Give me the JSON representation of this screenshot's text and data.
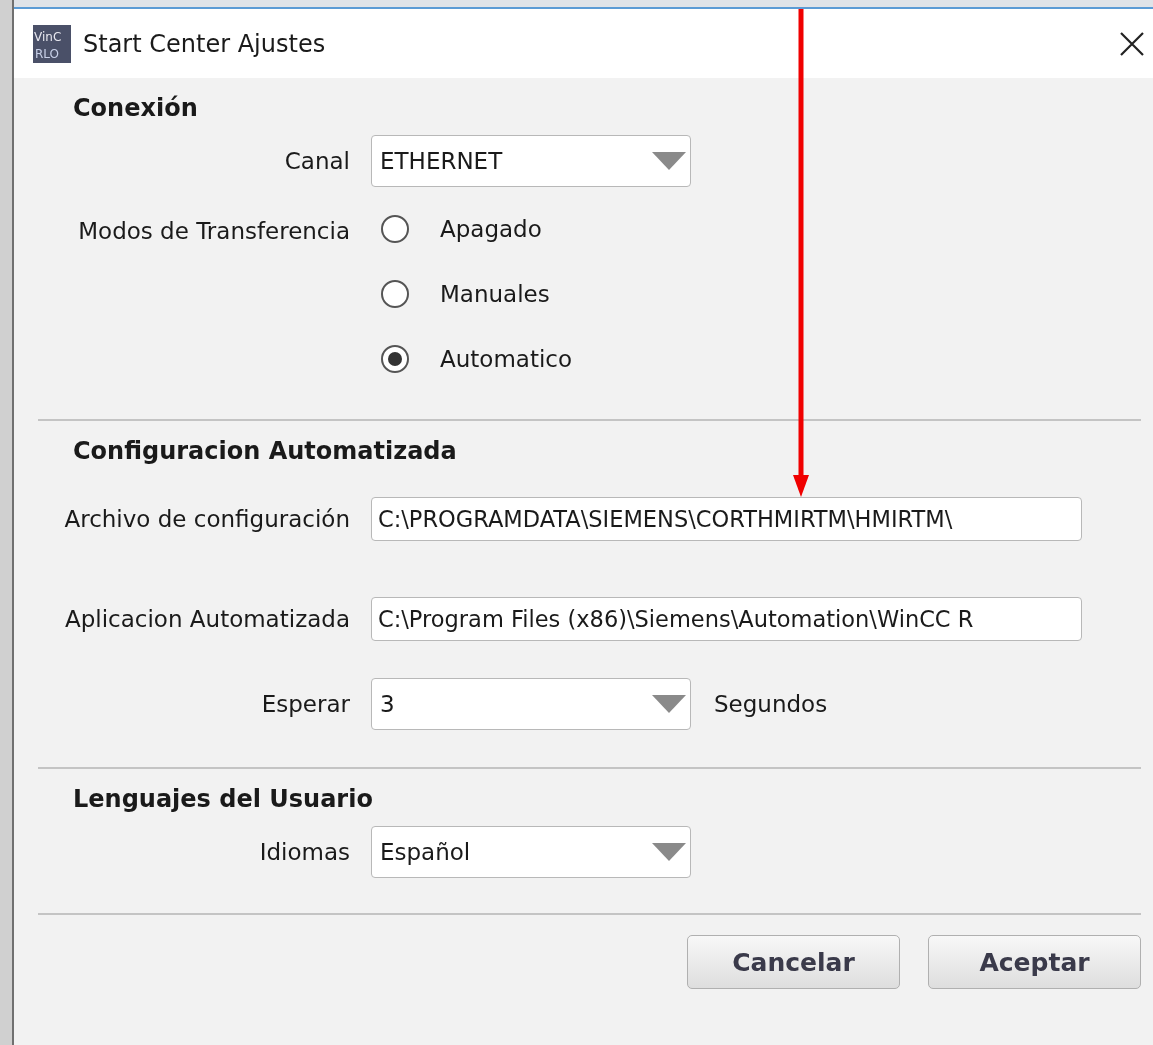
{
  "window": {
    "title": "Start Center Ajustes",
    "logo_lines": [
      "VinC",
      "RLO"
    ]
  },
  "sections": [
    {
      "heading": "Conexión",
      "rows": [
        {
          "kind": "dropdown",
          "label": "Canal",
          "value": "ETHERNET"
        },
        {
          "kind": "radio",
          "label": "Modos de Transferencia",
          "options": [
            {
              "label": "Apagado",
              "selected": false
            },
            {
              "label": "Manuales",
              "selected": false
            },
            {
              "label": "Automatico",
              "selected": true
            }
          ]
        }
      ]
    },
    {
      "heading": "Configuracion Automatizada",
      "rows": [
        {
          "kind": "text",
          "label": "Archivo de configuración",
          "value": "C:\\PROGRAMDATA\\SIEMENS\\CORTHMIRTM\\HMIRTM\\"
        },
        {
          "kind": "text",
          "label": "Aplicacion Automatizada",
          "value": "C:\\Program Files (x86)\\Siemens\\Automation\\WinCC R"
        },
        {
          "kind": "dropdown",
          "label": "Esperar",
          "value": "3",
          "unit": "Segundos"
        }
      ]
    },
    {
      "heading": "Lenguajes del Usuario",
      "rows": [
        {
          "kind": "dropdown",
          "label": "Idiomas",
          "value": "Español"
        }
      ]
    }
  ],
  "buttons": [
    "Cancelar",
    "Aceptar"
  ]
}
